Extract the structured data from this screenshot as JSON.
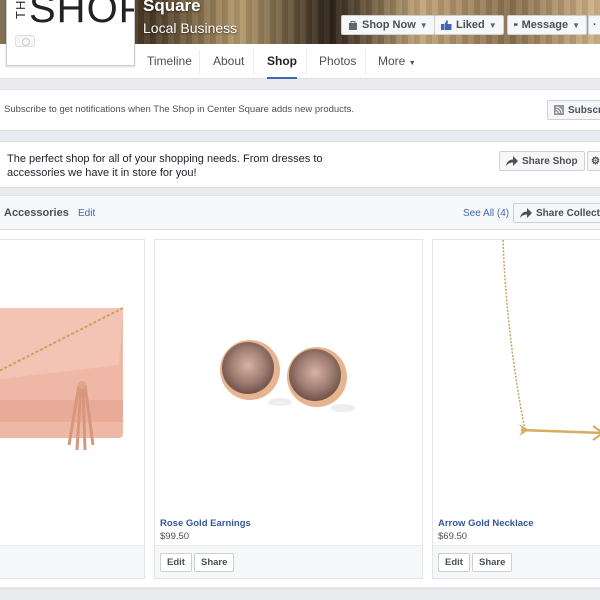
{
  "header": {
    "logo_prefix": "THE",
    "logo_main": "SHOP",
    "page_name": "Square",
    "page_category": "Local Business",
    "buttons": {
      "shop_now": "Shop Now",
      "liked": "Liked",
      "message": "Message"
    }
  },
  "nav": {
    "tabs": [
      {
        "label": "Timeline"
      },
      {
        "label": "About"
      },
      {
        "label": "Shop",
        "active": true
      },
      {
        "label": "Photos"
      },
      {
        "label": "More"
      }
    ]
  },
  "subscribe": {
    "text": "Subscribe to get notifications when The Shop in Center Square adds new products.",
    "button": "Subscri"
  },
  "shop_about": {
    "text": "The perfect shop for all of your shopping needs. From dresses to accessories we have it in store for you!",
    "share_button": "Share Shop"
  },
  "collection": {
    "title": "Accessories",
    "edit": "Edit",
    "see_all": "See All (4)",
    "share_button": "Share Collecti"
  },
  "products": [
    {
      "name": "",
      "price": "",
      "image": "pink-clutch"
    },
    {
      "name": "Rose Gold Earnings",
      "price": "$99.50",
      "image": "rose-gold-earrings",
      "edit": "Edit",
      "share": "Share"
    },
    {
      "name": "Arrow Gold Necklace",
      "price": "$69.50",
      "image": "arrow-necklace",
      "edit": "Edit",
      "share": "Share"
    }
  ],
  "colors": {
    "link": "#365899",
    "accent": "#4267b2",
    "like_blue": "#4267b2"
  }
}
